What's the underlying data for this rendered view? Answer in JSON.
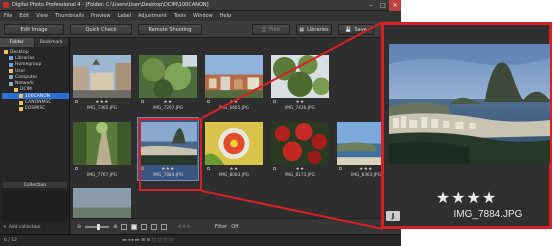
{
  "window": {
    "title": "Digital Photo Professional 4 - [Folder: C:\\Users\\User\\Desktop\\DCIM\\100CANON]"
  },
  "menu": [
    "File",
    "Edit",
    "View",
    "Thumbnails",
    "Preview",
    "Label",
    "Adjustment",
    "Tools",
    "Window",
    "Help"
  ],
  "toolbar": {
    "edit_image": "Edit Image",
    "quick_check": "Quick Check",
    "remote_shooting": "Remote Shooting",
    "print": "Print",
    "libraries": "Libraries",
    "save": "Save"
  },
  "left_panel": {
    "tabs": [
      "Folder",
      "Bookmark"
    ],
    "tree": [
      {
        "label": "Desktop",
        "indent": 0
      },
      {
        "label": "Libraries",
        "indent": 1
      },
      {
        "label": "Homegroup",
        "indent": 1
      },
      {
        "label": "User",
        "indent": 1
      },
      {
        "label": "Computer",
        "indent": 1
      },
      {
        "label": "Network",
        "indent": 1
      },
      {
        "label": "DCIM",
        "indent": 2
      },
      {
        "label": "100CANON",
        "indent": 3,
        "selected": true
      },
      {
        "label": "CANONMSC",
        "indent": 3
      },
      {
        "label": "EOSMISC",
        "indent": 3
      }
    ],
    "collection_label": "Collection",
    "add_collection": "Add collection"
  },
  "thumbnails": [
    {
      "file": "IMG_7365.JPG",
      "stars": "★★★",
      "scene": "street"
    },
    {
      "file": "IMG_7207.JPG",
      "stars": "★★",
      "scene": "plants"
    },
    {
      "file": "IMG_6665.JPG",
      "stars": "★★",
      "scene": "town"
    },
    {
      "file": "IMG_7436.JPG",
      "stars": "★★",
      "scene": "leaves"
    },
    {
      "file": "IMG_7767.JPG",
      "stars": "",
      "scene": "path"
    },
    {
      "file": "IMG_7884.JPG",
      "stars": "★★★",
      "scene": "bay",
      "selected": true
    },
    {
      "file": "IMG_8083.JPG",
      "stars": "★★",
      "scene": "flower"
    },
    {
      "file": "IMG_8173.JPG",
      "stars": "★★",
      "scene": "redflowers"
    },
    {
      "file": "IMG_8363.JPG",
      "stars": "★★★",
      "scene": "coast"
    }
  ],
  "bottom_bar": {
    "filter_label": "Filter",
    "filter_value": "Off"
  },
  "status": {
    "count": "6 / 12"
  },
  "zoom": {
    "stars": "★★★★",
    "filename": "IMG_7884.JPG",
    "badge": "J"
  },
  "colors": {
    "highlight": "#d81f26",
    "selection": "#2a6fd6"
  }
}
